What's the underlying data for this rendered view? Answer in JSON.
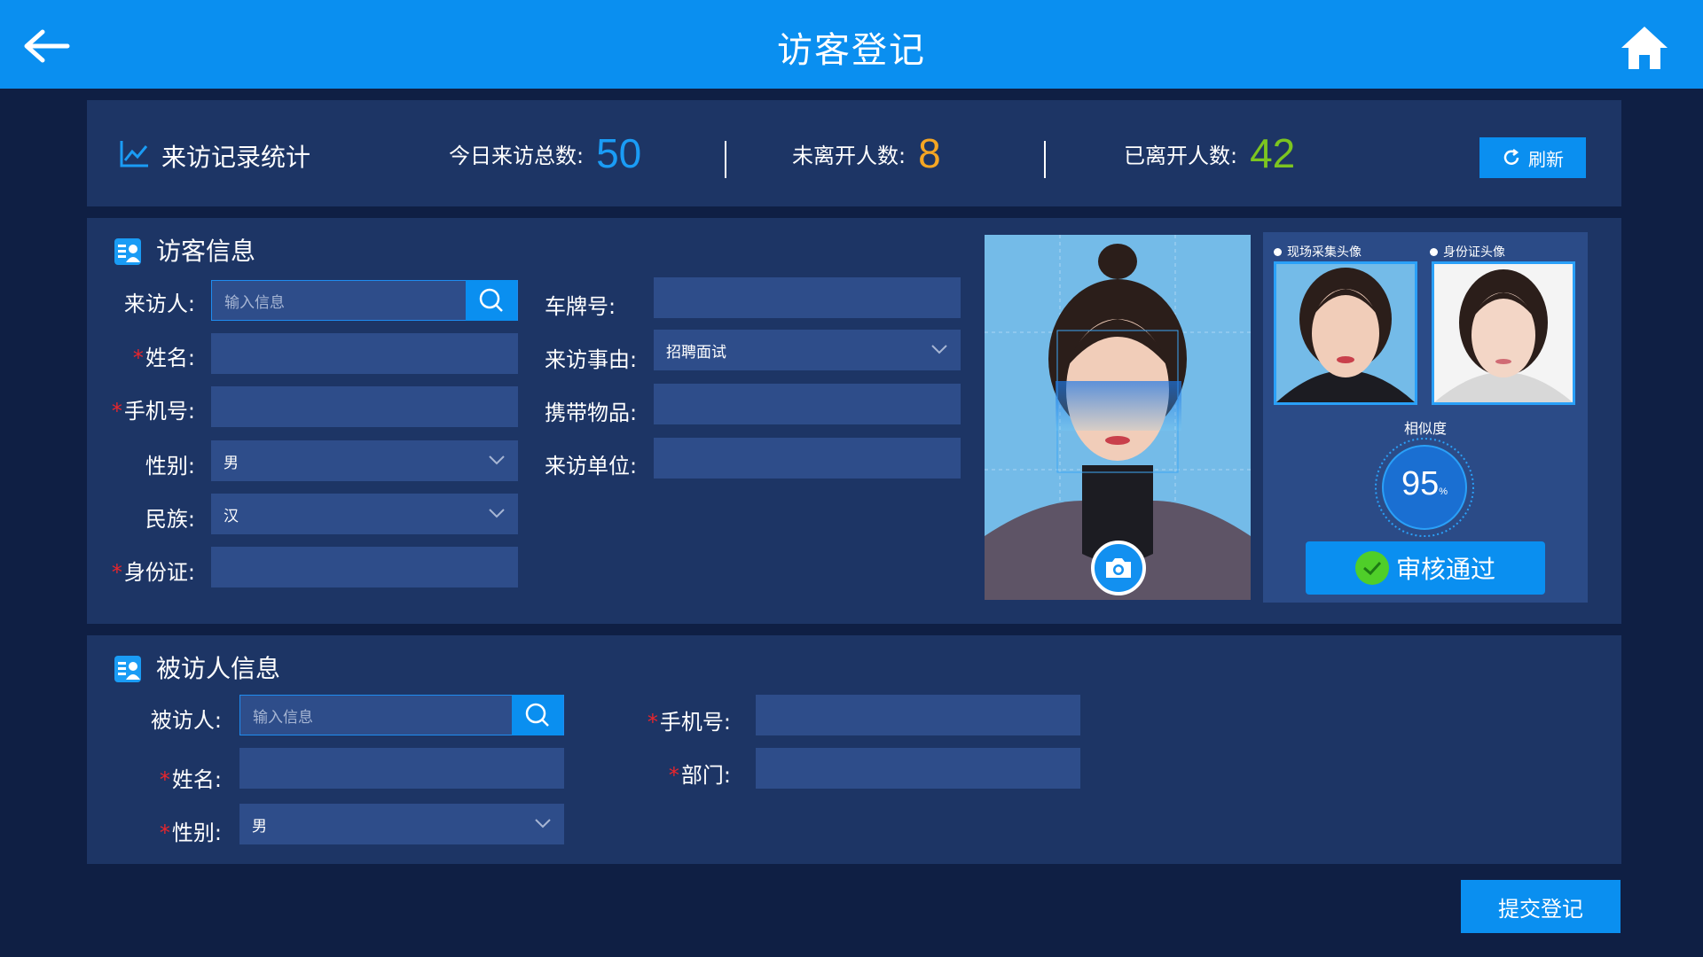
{
  "header": {
    "title": "访客登记",
    "back_icon": "arrow-left-icon",
    "home_icon": "home-icon"
  },
  "stats": {
    "title": "来访记录统计",
    "today_label": "今日来访总数:",
    "today_value": "50",
    "today_color": "#1a9cf5",
    "not_left_label": "未离开人数:",
    "not_left_value": "8",
    "not_left_color": "#f5a623",
    "left_label": "已离开人数:",
    "left_value": "42",
    "left_color": "#7cc520",
    "refresh_label": "刷新"
  },
  "visitor": {
    "title": "访客信息",
    "visitor_label": "来访人:",
    "visitor_placeholder": "输入信息",
    "name_label": "姓名:",
    "phone_label": "手机号:",
    "gender_label": "性别:",
    "gender_value": "男",
    "ethnicity_label": "民族:",
    "ethnicity_value": "汉",
    "id_label": "身份证:",
    "plate_label": "车牌号:",
    "reason_label": "来访事由:",
    "reason_value": "招聘面试",
    "items_label": "携带物品:",
    "unit_label": "来访单位:",
    "required_mark": "*"
  },
  "compare": {
    "live_label": "现场采集头像",
    "id_label": "身份证头像",
    "similarity_label": "相似度",
    "similarity_value": "95",
    "similarity_unit": "%",
    "similarity_fraction": 0.95,
    "approve_label": "审核通过"
  },
  "host": {
    "title": "被访人信息",
    "host_label": "被访人:",
    "host_placeholder": "输入信息",
    "name_label": "姓名:",
    "gender_label": "性别:",
    "gender_value": "男",
    "phone_label": "手机号:",
    "dept_label": "部门:",
    "required_mark": "*"
  },
  "submit_label": "提交登记",
  "colors": {
    "primary": "#0a8ff0",
    "background": "#0f1f44",
    "panel": "#1d3565",
    "input": "#2e4d8a",
    "required": "#e8262c"
  }
}
